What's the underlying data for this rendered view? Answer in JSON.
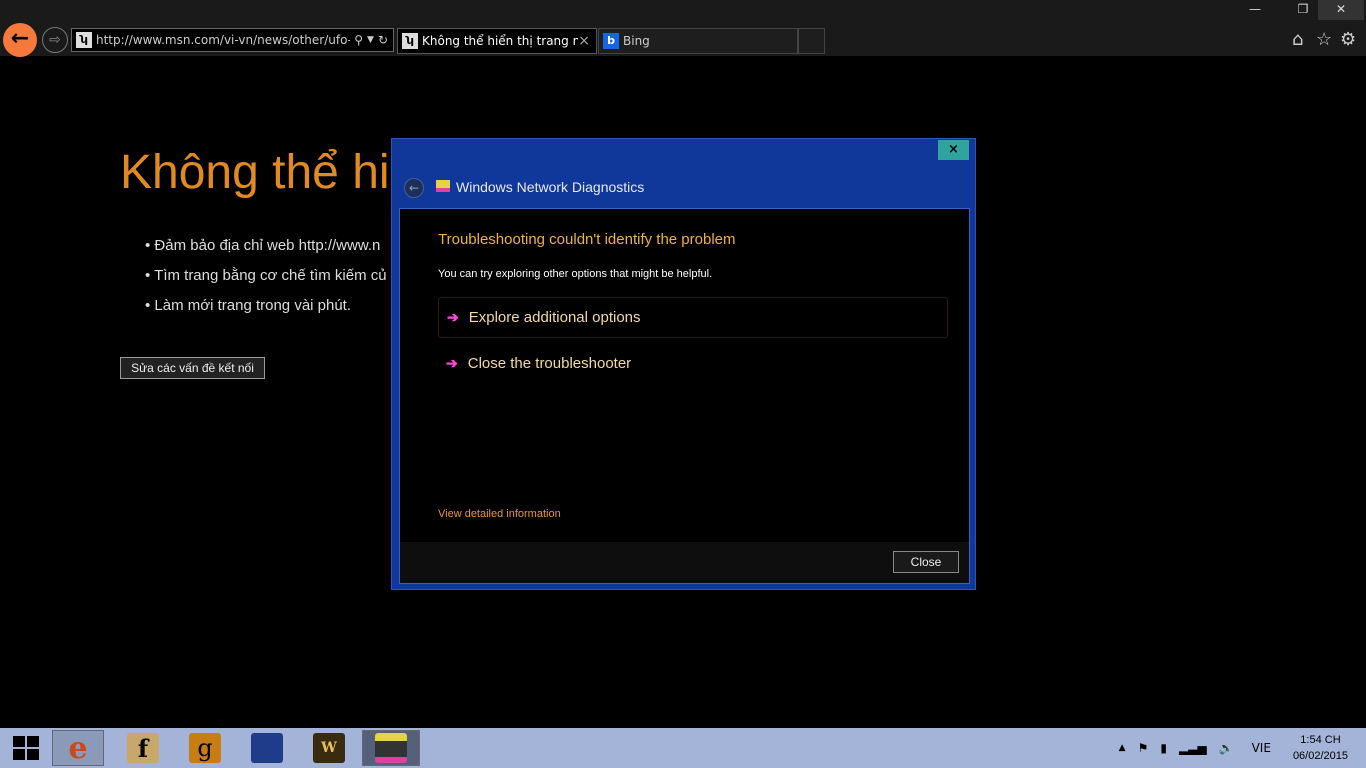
{
  "browser": {
    "address": "http://www.msn.com/vi-vn/news/other/ufo-l",
    "tabs": [
      {
        "label": "Không thể hiển thị trang này",
        "close": "×"
      },
      {
        "label": "Bing"
      }
    ],
    "window_controls": {
      "minimize": "—",
      "restore": "❐",
      "close": "✕"
    }
  },
  "page": {
    "title": "Không thể hi",
    "bullets": [
      "Đảm bảo địa chỉ web http://www.n",
      "Tìm trang bằng cơ chế tìm kiếm củ",
      "Làm mới trang trong vài phút."
    ],
    "fix_button": "Sửa các vấn đề kết nối"
  },
  "dialog": {
    "title": "Windows Network Diagnostics",
    "heading": "Troubleshooting couldn't identify the problem",
    "subtext": "You can try exploring other options that might be helpful.",
    "options": [
      {
        "label": "Explore additional options"
      },
      {
        "label": "Close the troubleshooter"
      }
    ],
    "link": "View detailed information",
    "close_button": "Close",
    "close_x": "×",
    "accent": "#10389a"
  },
  "taskbar": {
    "apps": [
      {
        "icon": "internet-explorer"
      },
      {
        "icon": "facebook",
        "glyph": "f"
      },
      {
        "icon": "google",
        "glyph": "g"
      },
      {
        "icon": "file-explorer"
      },
      {
        "icon": "word"
      },
      {
        "icon": "network-diagnostics"
      }
    ],
    "tray": {
      "language": "VIE",
      "time": "1:54 CH",
      "date": "06/02/2015"
    }
  }
}
